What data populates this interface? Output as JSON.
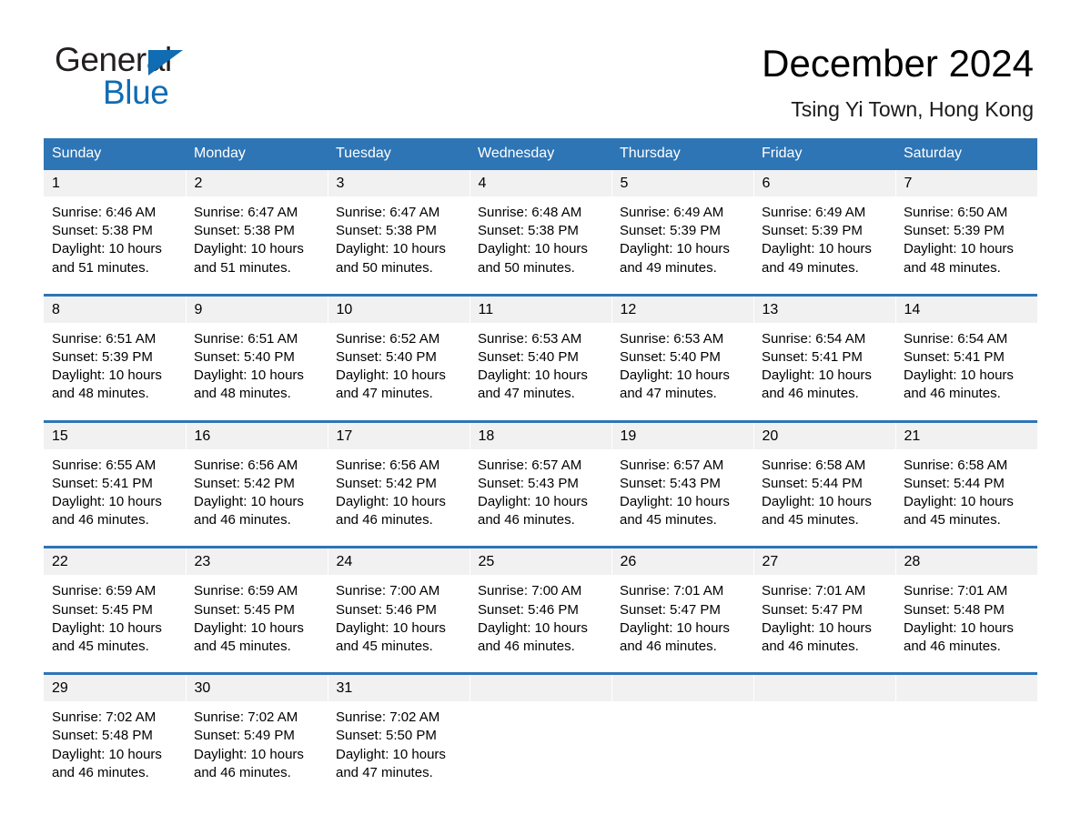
{
  "brand": {
    "name_part1": "General",
    "name_part2": "Blue",
    "logo_icon": "triangle-flag-icon",
    "accent_color": "#106cb3"
  },
  "header": {
    "title": "December 2024",
    "subtitle": "Tsing Yi Town, Hong Kong"
  },
  "theme": {
    "header_blue": "#2e75b5",
    "row_gray": "#f1f1f1",
    "text_black": "#000000"
  },
  "calendar": {
    "day_headers": [
      "Sunday",
      "Monday",
      "Tuesday",
      "Wednesday",
      "Thursday",
      "Friday",
      "Saturday"
    ],
    "labels": {
      "sunrise": "Sunrise:",
      "sunset": "Sunset:",
      "daylight": "Daylight:"
    },
    "weeks": [
      [
        {
          "day": "1",
          "sunrise": "Sunrise: 6:46 AM",
          "sunset": "Sunset: 5:38 PM",
          "daylight_a": "Daylight: 10 hours",
          "daylight_b": "and 51 minutes."
        },
        {
          "day": "2",
          "sunrise": "Sunrise: 6:47 AM",
          "sunset": "Sunset: 5:38 PM",
          "daylight_a": "Daylight: 10 hours",
          "daylight_b": "and 51 minutes."
        },
        {
          "day": "3",
          "sunrise": "Sunrise: 6:47 AM",
          "sunset": "Sunset: 5:38 PM",
          "daylight_a": "Daylight: 10 hours",
          "daylight_b": "and 50 minutes."
        },
        {
          "day": "4",
          "sunrise": "Sunrise: 6:48 AM",
          "sunset": "Sunset: 5:38 PM",
          "daylight_a": "Daylight: 10 hours",
          "daylight_b": "and 50 minutes."
        },
        {
          "day": "5",
          "sunrise": "Sunrise: 6:49 AM",
          "sunset": "Sunset: 5:39 PM",
          "daylight_a": "Daylight: 10 hours",
          "daylight_b": "and 49 minutes."
        },
        {
          "day": "6",
          "sunrise": "Sunrise: 6:49 AM",
          "sunset": "Sunset: 5:39 PM",
          "daylight_a": "Daylight: 10 hours",
          "daylight_b": "and 49 minutes."
        },
        {
          "day": "7",
          "sunrise": "Sunrise: 6:50 AM",
          "sunset": "Sunset: 5:39 PM",
          "daylight_a": "Daylight: 10 hours",
          "daylight_b": "and 48 minutes."
        }
      ],
      [
        {
          "day": "8",
          "sunrise": "Sunrise: 6:51 AM",
          "sunset": "Sunset: 5:39 PM",
          "daylight_a": "Daylight: 10 hours",
          "daylight_b": "and 48 minutes."
        },
        {
          "day": "9",
          "sunrise": "Sunrise: 6:51 AM",
          "sunset": "Sunset: 5:40 PM",
          "daylight_a": "Daylight: 10 hours",
          "daylight_b": "and 48 minutes."
        },
        {
          "day": "10",
          "sunrise": "Sunrise: 6:52 AM",
          "sunset": "Sunset: 5:40 PM",
          "daylight_a": "Daylight: 10 hours",
          "daylight_b": "and 47 minutes."
        },
        {
          "day": "11",
          "sunrise": "Sunrise: 6:53 AM",
          "sunset": "Sunset: 5:40 PM",
          "daylight_a": "Daylight: 10 hours",
          "daylight_b": "and 47 minutes."
        },
        {
          "day": "12",
          "sunrise": "Sunrise: 6:53 AM",
          "sunset": "Sunset: 5:40 PM",
          "daylight_a": "Daylight: 10 hours",
          "daylight_b": "and 47 minutes."
        },
        {
          "day": "13",
          "sunrise": "Sunrise: 6:54 AM",
          "sunset": "Sunset: 5:41 PM",
          "daylight_a": "Daylight: 10 hours",
          "daylight_b": "and 46 minutes."
        },
        {
          "day": "14",
          "sunrise": "Sunrise: 6:54 AM",
          "sunset": "Sunset: 5:41 PM",
          "daylight_a": "Daylight: 10 hours",
          "daylight_b": "and 46 minutes."
        }
      ],
      [
        {
          "day": "15",
          "sunrise": "Sunrise: 6:55 AM",
          "sunset": "Sunset: 5:41 PM",
          "daylight_a": "Daylight: 10 hours",
          "daylight_b": "and 46 minutes."
        },
        {
          "day": "16",
          "sunrise": "Sunrise: 6:56 AM",
          "sunset": "Sunset: 5:42 PM",
          "daylight_a": "Daylight: 10 hours",
          "daylight_b": "and 46 minutes."
        },
        {
          "day": "17",
          "sunrise": "Sunrise: 6:56 AM",
          "sunset": "Sunset: 5:42 PM",
          "daylight_a": "Daylight: 10 hours",
          "daylight_b": "and 46 minutes."
        },
        {
          "day": "18",
          "sunrise": "Sunrise: 6:57 AM",
          "sunset": "Sunset: 5:43 PM",
          "daylight_a": "Daylight: 10 hours",
          "daylight_b": "and 46 minutes."
        },
        {
          "day": "19",
          "sunrise": "Sunrise: 6:57 AM",
          "sunset": "Sunset: 5:43 PM",
          "daylight_a": "Daylight: 10 hours",
          "daylight_b": "and 45 minutes."
        },
        {
          "day": "20",
          "sunrise": "Sunrise: 6:58 AM",
          "sunset": "Sunset: 5:44 PM",
          "daylight_a": "Daylight: 10 hours",
          "daylight_b": "and 45 minutes."
        },
        {
          "day": "21",
          "sunrise": "Sunrise: 6:58 AM",
          "sunset": "Sunset: 5:44 PM",
          "daylight_a": "Daylight: 10 hours",
          "daylight_b": "and 45 minutes."
        }
      ],
      [
        {
          "day": "22",
          "sunrise": "Sunrise: 6:59 AM",
          "sunset": "Sunset: 5:45 PM",
          "daylight_a": "Daylight: 10 hours",
          "daylight_b": "and 45 minutes."
        },
        {
          "day": "23",
          "sunrise": "Sunrise: 6:59 AM",
          "sunset": "Sunset: 5:45 PM",
          "daylight_a": "Daylight: 10 hours",
          "daylight_b": "and 45 minutes."
        },
        {
          "day": "24",
          "sunrise": "Sunrise: 7:00 AM",
          "sunset": "Sunset: 5:46 PM",
          "daylight_a": "Daylight: 10 hours",
          "daylight_b": "and 45 minutes."
        },
        {
          "day": "25",
          "sunrise": "Sunrise: 7:00 AM",
          "sunset": "Sunset: 5:46 PM",
          "daylight_a": "Daylight: 10 hours",
          "daylight_b": "and 46 minutes."
        },
        {
          "day": "26",
          "sunrise": "Sunrise: 7:01 AM",
          "sunset": "Sunset: 5:47 PM",
          "daylight_a": "Daylight: 10 hours",
          "daylight_b": "and 46 minutes."
        },
        {
          "day": "27",
          "sunrise": "Sunrise: 7:01 AM",
          "sunset": "Sunset: 5:47 PM",
          "daylight_a": "Daylight: 10 hours",
          "daylight_b": "and 46 minutes."
        },
        {
          "day": "28",
          "sunrise": "Sunrise: 7:01 AM",
          "sunset": "Sunset: 5:48 PM",
          "daylight_a": "Daylight: 10 hours",
          "daylight_b": "and 46 minutes."
        }
      ],
      [
        {
          "day": "29",
          "sunrise": "Sunrise: 7:02 AM",
          "sunset": "Sunset: 5:48 PM",
          "daylight_a": "Daylight: 10 hours",
          "daylight_b": "and 46 minutes."
        },
        {
          "day": "30",
          "sunrise": "Sunrise: 7:02 AM",
          "sunset": "Sunset: 5:49 PM",
          "daylight_a": "Daylight: 10 hours",
          "daylight_b": "and 46 minutes."
        },
        {
          "day": "31",
          "sunrise": "Sunrise: 7:02 AM",
          "sunset": "Sunset: 5:50 PM",
          "daylight_a": "Daylight: 10 hours",
          "daylight_b": "and 47 minutes."
        },
        {
          "day": "",
          "sunrise": "",
          "sunset": "",
          "daylight_a": "",
          "daylight_b": ""
        },
        {
          "day": "",
          "sunrise": "",
          "sunset": "",
          "daylight_a": "",
          "daylight_b": ""
        },
        {
          "day": "",
          "sunrise": "",
          "sunset": "",
          "daylight_a": "",
          "daylight_b": ""
        },
        {
          "day": "",
          "sunrise": "",
          "sunset": "",
          "daylight_a": "",
          "daylight_b": ""
        }
      ]
    ]
  }
}
